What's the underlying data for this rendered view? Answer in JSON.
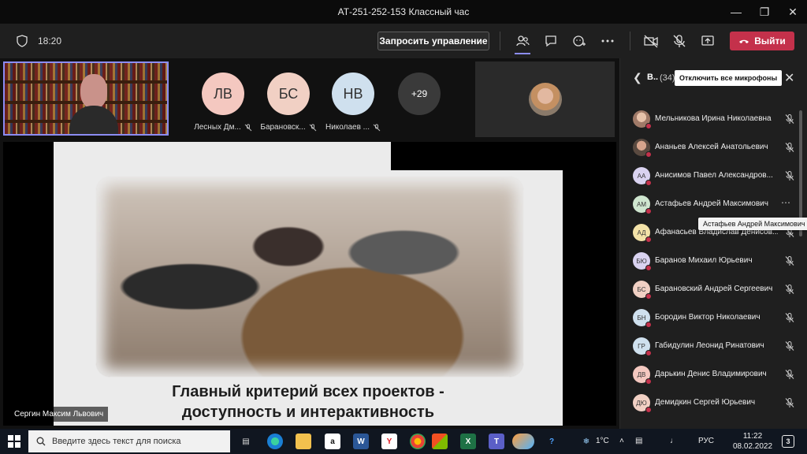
{
  "window": {
    "title": "АТ-251-252-153 Классный час",
    "controls": [
      "minimize",
      "restore",
      "close"
    ]
  },
  "toolbar": {
    "timer": "18:20",
    "request_control_label": "Запросить управление",
    "leave_label": "Выйти",
    "leave_color": "#c4314b",
    "accent_color": "#8b8cf3"
  },
  "stage": {
    "self_view_name": "Сергин Максим Львович",
    "participants": [
      {
        "initials": "ЛВ",
        "name": "Лесных Дм...",
        "color": "#f4c8c0"
      },
      {
        "initials": "БС",
        "name": "Барановск...",
        "color": "#f1d0c4"
      },
      {
        "initials": "НВ",
        "name": "Николаев ...",
        "color": "#cfe0ee"
      }
    ],
    "more_count": "+29",
    "slide": {
      "line1": "Главный критерий всех проектов -",
      "line2": "доступность и интерактивность"
    }
  },
  "panel": {
    "title": "В..",
    "count": "(34)",
    "mute_all_label": "Отключить все микрофоны",
    "tooltip": "Астафьев Андрей Максимович",
    "participants": [
      {
        "initials": "",
        "name": "Мельникова Ирина Николаевна",
        "color": "#c8a08a",
        "photo": true
      },
      {
        "initials": "",
        "name": "Ананьев Алексей Анатольевич",
        "color": "#9a7060",
        "photo": true
      },
      {
        "initials": "АА",
        "name": "Анисимов Павел Александров...",
        "color": "#d9d2f0"
      },
      {
        "initials": "АМ",
        "name": "Астафьев Андрей Максимович",
        "color": "#cfe6cf",
        "hover": true
      },
      {
        "initials": "АД",
        "name": "Афанасьев Владислав Денисов...",
        "color": "#f3e2a8"
      },
      {
        "initials": "БЮ",
        "name": "Баранов Михаил Юрьевич",
        "color": "#d9d2f0"
      },
      {
        "initials": "БС",
        "name": "Барановский Андрей Сергеевич",
        "color": "#f1d0c4"
      },
      {
        "initials": "БН",
        "name": "Бородин Виктор Николаевич",
        "color": "#cfe0ee"
      },
      {
        "initials": "ГР",
        "name": "Габидулин Леонид Ринатович",
        "color": "#cfe0ee"
      },
      {
        "initials": "ДВ",
        "name": "Дарькин Денис Владимирович",
        "color": "#f4c8c0"
      },
      {
        "initials": "ДЮ",
        "name": "Демидкин Сергей Юрьевич",
        "color": "#f1d0c4"
      }
    ]
  },
  "taskbar": {
    "search_placeholder": "Введите здесь текст для поиска",
    "temperature": "1°C",
    "language": "РУС",
    "time": "11:22",
    "date": "08.02.2022",
    "notifications": "3"
  }
}
